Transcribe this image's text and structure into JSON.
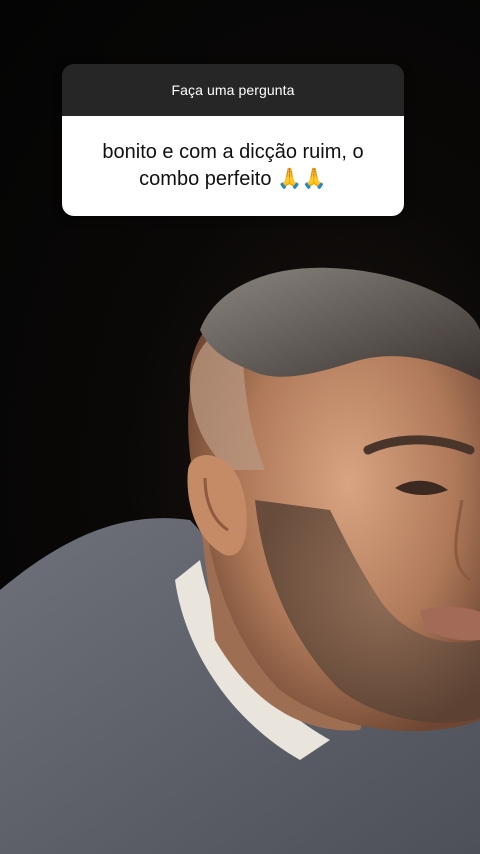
{
  "question_box": {
    "header": "Faça uma pergunta",
    "answer": "bonito e com a dicção ruim, o combo perfeito 🙏🙏"
  },
  "background": {
    "scene": "selfie-video-frame",
    "accent_colors": {
      "header_bg": "#262626",
      "card_bg": "#ffffff",
      "backdrop": "#050505"
    }
  }
}
